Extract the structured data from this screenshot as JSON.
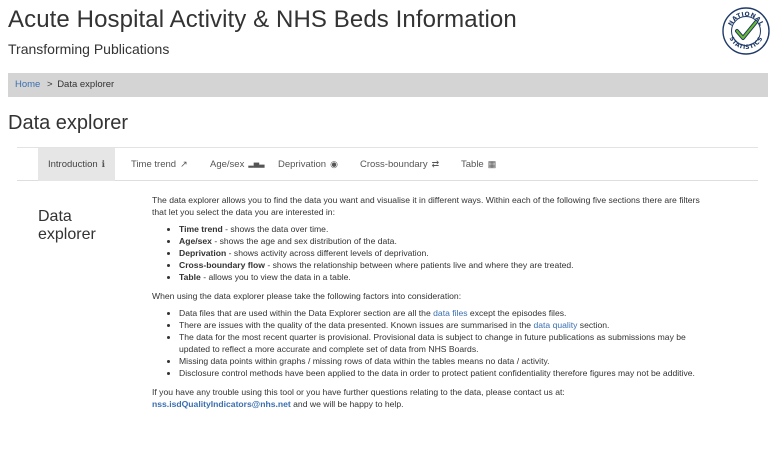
{
  "header": {
    "title": "Acute Hospital Activity & NHS Beds Information",
    "subtitle": "Transforming Publications",
    "logo_text_top": "NATIONAL",
    "logo_text_bottom": "STATISTICS"
  },
  "breadcrumb": {
    "home": "Home",
    "separator": ">",
    "current": "Data explorer"
  },
  "page": {
    "title": "Data explorer",
    "side_heading": "Data explorer"
  },
  "tabs": [
    {
      "label": "Introduction",
      "icon": "info-icon",
      "glyph": "ℹ",
      "active": true
    },
    {
      "label": "Time trend",
      "icon": "line-chart-icon",
      "glyph": "↗",
      "active": false
    },
    {
      "label": "Age/sex",
      "icon": "bar-chart-icon",
      "glyph": "▂▅▃",
      "active": false
    },
    {
      "label": "Deprivation",
      "icon": "user-circle-icon",
      "glyph": "◉",
      "active": false
    },
    {
      "label": "Cross-boundary",
      "icon": "exchange-icon",
      "glyph": "⇄",
      "active": false
    },
    {
      "label": "Table",
      "icon": "table-icon",
      "glyph": "▦",
      "active": false
    }
  ],
  "content": {
    "intro": "The data explorer allows you to find the data you want and visualise it in different ways. Within each of the following five sections there are filters that let you select the data you are interested in:",
    "sections": [
      {
        "term": "Time trend",
        "desc": " - shows the data over time."
      },
      {
        "term": "Age/sex",
        "desc": " - shows the age and sex distribution of the data."
      },
      {
        "term": "Deprivation",
        "desc": " - shows activity across different levels of deprivation."
      },
      {
        "term": "Cross-boundary flow",
        "desc": " - shows the relationship between where patients live and where they are treated."
      },
      {
        "term": "Table",
        "desc": " - allows you to view the data in a table."
      }
    ],
    "factors_intro": "When using the data explorer please take the following factors into consideration:",
    "factor1_pre": "Data files that are used within the Data Explorer section are all the ",
    "factor1_link": "data files",
    "factor1_post": " except the episodes files.",
    "factor2_pre": "There are issues with the quality of the data presented. Known issues are summarised in the ",
    "factor2_link": "data quality",
    "factor2_post": " section.",
    "factor3": "The data for the most recent quarter is provisional. Provisional data is subject to change in future publications as submissions may be updated to reflect a more accurate and complete set of data from NHS Boards.",
    "factor4": "Missing data points within graphs / missing rows of data within the tables means no data / activity.",
    "factor5": "Disclosure control methods have been applied to the data in order to protect patient confidentiality therefore figures may not be additive.",
    "contact_pre": "If you have any trouble using this tool or you have further questions relating to the data, please contact us at:",
    "contact_email": "nss.isdQualityIndicators@nhs.net",
    "contact_post": " and we will be happy to help."
  },
  "colors": {
    "link": "#3a6fb0",
    "breadcrumb_bg": "#d4d4d4",
    "active_tab_bg": "#e6e6e6",
    "logo_navy": "#1f3a68",
    "logo_green": "#6bbf2a"
  }
}
